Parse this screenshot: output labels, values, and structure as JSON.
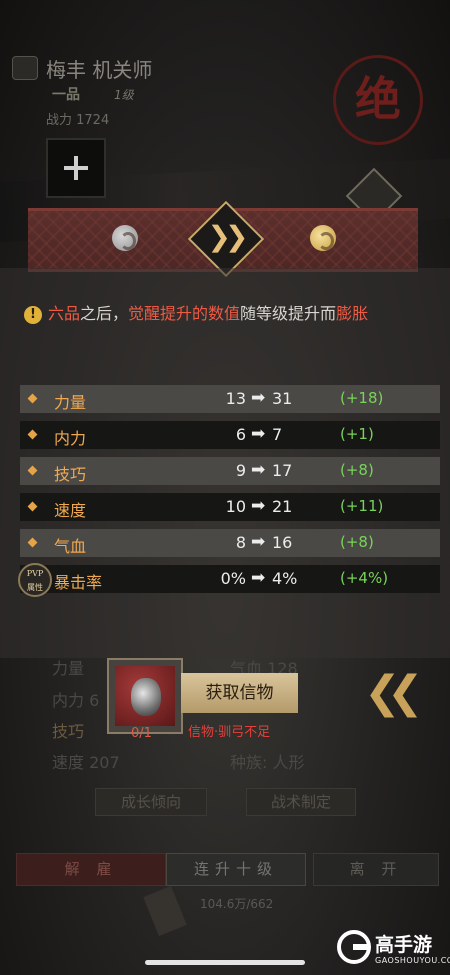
{
  "header": {
    "name": "梅丰  机关师",
    "rank": "一品",
    "level": "1级",
    "power": "战力  1724",
    "seal": "绝"
  },
  "notice": {
    "p1": "六品",
    "p2": "之后，",
    "p3": "觉醒提升的数值",
    "p4": "随等级提升而",
    "p5": "膨胀"
  },
  "stats": [
    {
      "label": "力量",
      "from": "13",
      "to": "31",
      "gain": "(+18)"
    },
    {
      "label": "内力",
      "from": "6",
      "to": "7",
      "gain": "(+1)"
    },
    {
      "label": "技巧",
      "from": "9",
      "to": "17",
      "gain": "(+8)"
    },
    {
      "label": "速度",
      "from": "10",
      "to": "21",
      "gain": "(+11)"
    },
    {
      "label": "气血",
      "from": "8",
      "to": "16",
      "gain": "(+8)"
    },
    {
      "label": "暴击率",
      "from": "0%",
      "to": "4%",
      "gain": "(+4%)"
    }
  ],
  "pvp_badge": {
    "line1": "PVP",
    "line2": "属性"
  },
  "background_stats": {
    "strength": "力量",
    "hp": "气血  128",
    "inner": "内力  6",
    "skill": "技巧",
    "speed": "速度  207",
    "race": "种族: 人形"
  },
  "background_buttons": {
    "growth": "成长倾向",
    "tactics": "战术制定"
  },
  "item_popup": {
    "count": "0/1",
    "get_label": "获取信物",
    "insufficient": "信物·驯弓不足"
  },
  "bottom": {
    "fire": "解 雇",
    "upten": "连升十级",
    "leave": "离 开",
    "money": "104.6万/662"
  },
  "watermark": {
    "name": "高手游",
    "domain": "GAOSHOUYOU.COM"
  }
}
